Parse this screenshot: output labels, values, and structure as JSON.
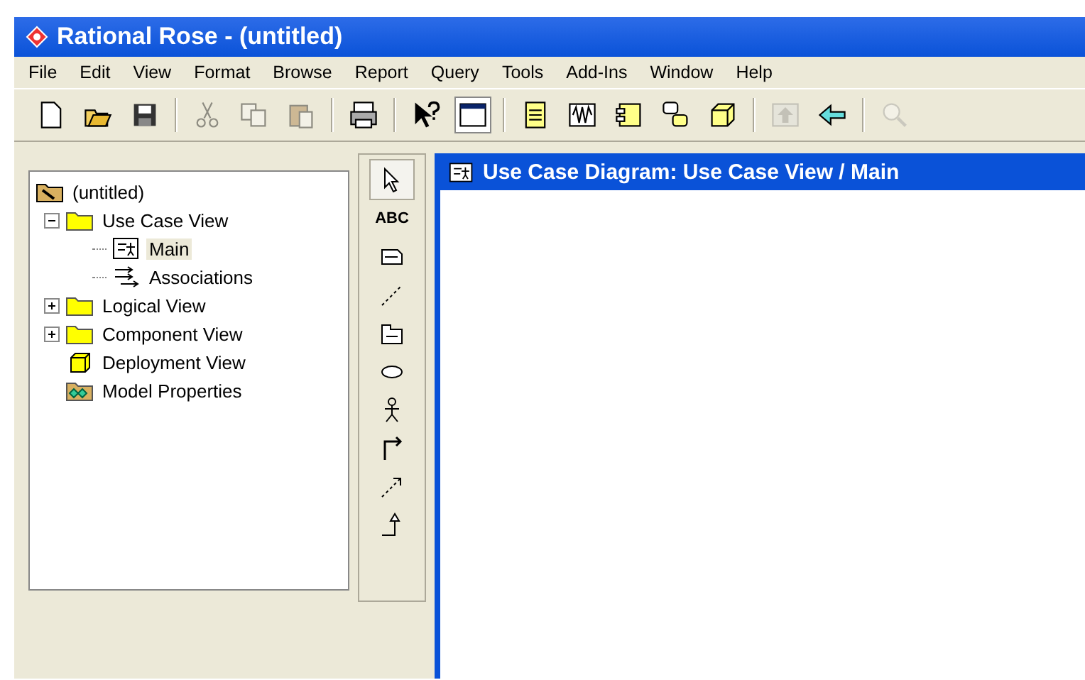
{
  "window": {
    "title": "Rational Rose - (untitled)"
  },
  "menu": [
    "File",
    "Edit",
    "View",
    "Format",
    "Browse",
    "Report",
    "Query",
    "Tools",
    "Add-Ins",
    "Window",
    "Help"
  ],
  "toolbar": [
    {
      "kind": "new",
      "disabled": false,
      "selected": false
    },
    {
      "kind": "open",
      "disabled": false,
      "selected": false
    },
    {
      "kind": "save",
      "disabled": false,
      "selected": false
    },
    {
      "kind": "sep"
    },
    {
      "kind": "cut",
      "disabled": true,
      "selected": false
    },
    {
      "kind": "copy",
      "disabled": true,
      "selected": false
    },
    {
      "kind": "paste",
      "disabled": true,
      "selected": false
    },
    {
      "kind": "sep"
    },
    {
      "kind": "print",
      "disabled": false,
      "selected": false
    },
    {
      "kind": "sep"
    },
    {
      "kind": "help",
      "disabled": false,
      "selected": false
    },
    {
      "kind": "window",
      "disabled": false,
      "selected": true
    },
    {
      "kind": "sep"
    },
    {
      "kind": "doc",
      "disabled": false,
      "selected": false
    },
    {
      "kind": "wave",
      "disabled": false,
      "selected": false
    },
    {
      "kind": "component",
      "disabled": false,
      "selected": false
    },
    {
      "kind": "state",
      "disabled": false,
      "selected": false
    },
    {
      "kind": "cube",
      "disabled": false,
      "selected": false
    },
    {
      "kind": "sep"
    },
    {
      "kind": "up",
      "disabled": true,
      "selected": false
    },
    {
      "kind": "back",
      "disabled": false,
      "selected": false
    },
    {
      "kind": "sep"
    },
    {
      "kind": "zoom",
      "disabled": true,
      "selected": false
    }
  ],
  "browser": {
    "root": {
      "label": "(untitled)",
      "kind": "model"
    },
    "items": [
      {
        "label": "Use Case View",
        "kind": "folder",
        "expanded": true,
        "selected": false,
        "children": [
          {
            "label": "Main",
            "kind": "diagram",
            "selected": true
          },
          {
            "label": "Associations",
            "kind": "associations",
            "selected": false
          }
        ]
      },
      {
        "label": "Logical View",
        "kind": "folder",
        "expanded": false,
        "selected": false
      },
      {
        "label": "Component View",
        "kind": "folder",
        "expanded": false,
        "selected": false
      },
      {
        "label": "Deployment View",
        "kind": "cube",
        "selected": false
      },
      {
        "label": "Model Properties",
        "kind": "properties",
        "selected": false
      }
    ]
  },
  "toolbox": [
    {
      "kind": "pointer",
      "selected": true
    },
    {
      "kind": "text",
      "label": "ABC",
      "selected": false
    },
    {
      "kind": "note",
      "selected": false
    },
    {
      "kind": "anchor",
      "selected": false
    },
    {
      "kind": "package",
      "selected": false
    },
    {
      "kind": "usecase",
      "selected": false
    },
    {
      "kind": "actor",
      "selected": false
    },
    {
      "kind": "association",
      "selected": false
    },
    {
      "kind": "dependency",
      "selected": false
    },
    {
      "kind": "generalization",
      "selected": false
    }
  ],
  "diagram": {
    "title": "Use Case Diagram: Use Case View / Main"
  }
}
